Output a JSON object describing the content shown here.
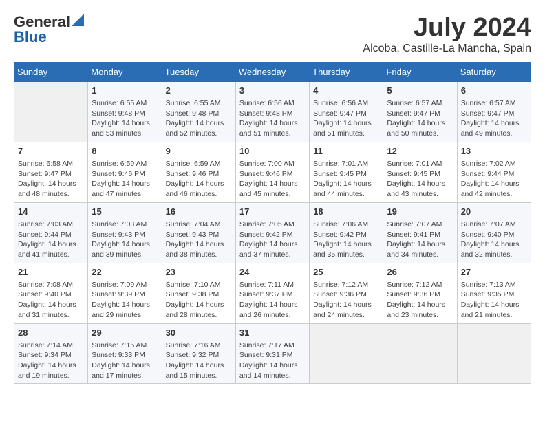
{
  "logo": {
    "general": "General",
    "blue": "Blue"
  },
  "title": "July 2024",
  "subtitle": "Alcoba, Castille-La Mancha, Spain",
  "weekdays": [
    "Sunday",
    "Monday",
    "Tuesday",
    "Wednesday",
    "Thursday",
    "Friday",
    "Saturday"
  ],
  "weeks": [
    [
      {
        "day": "",
        "empty": true
      },
      {
        "day": "1",
        "sunrise": "6:55 AM",
        "sunset": "9:48 PM",
        "daylight": "14 hours and 53 minutes."
      },
      {
        "day": "2",
        "sunrise": "6:55 AM",
        "sunset": "9:48 PM",
        "daylight": "14 hours and 52 minutes."
      },
      {
        "day": "3",
        "sunrise": "6:56 AM",
        "sunset": "9:48 PM",
        "daylight": "14 hours and 51 minutes."
      },
      {
        "day": "4",
        "sunrise": "6:56 AM",
        "sunset": "9:47 PM",
        "daylight": "14 hours and 51 minutes."
      },
      {
        "day": "5",
        "sunrise": "6:57 AM",
        "sunset": "9:47 PM",
        "daylight": "14 hours and 50 minutes."
      },
      {
        "day": "6",
        "sunrise": "6:57 AM",
        "sunset": "9:47 PM",
        "daylight": "14 hours and 49 minutes."
      }
    ],
    [
      {
        "day": "7",
        "sunrise": "6:58 AM",
        "sunset": "9:47 PM",
        "daylight": "14 hours and 48 minutes."
      },
      {
        "day": "8",
        "sunrise": "6:59 AM",
        "sunset": "9:46 PM",
        "daylight": "14 hours and 47 minutes."
      },
      {
        "day": "9",
        "sunrise": "6:59 AM",
        "sunset": "9:46 PM",
        "daylight": "14 hours and 46 minutes."
      },
      {
        "day": "10",
        "sunrise": "7:00 AM",
        "sunset": "9:46 PM",
        "daylight": "14 hours and 45 minutes."
      },
      {
        "day": "11",
        "sunrise": "7:01 AM",
        "sunset": "9:45 PM",
        "daylight": "14 hours and 44 minutes."
      },
      {
        "day": "12",
        "sunrise": "7:01 AM",
        "sunset": "9:45 PM",
        "daylight": "14 hours and 43 minutes."
      },
      {
        "day": "13",
        "sunrise": "7:02 AM",
        "sunset": "9:44 PM",
        "daylight": "14 hours and 42 minutes."
      }
    ],
    [
      {
        "day": "14",
        "sunrise": "7:03 AM",
        "sunset": "9:44 PM",
        "daylight": "14 hours and 41 minutes."
      },
      {
        "day": "15",
        "sunrise": "7:03 AM",
        "sunset": "9:43 PM",
        "daylight": "14 hours and 39 minutes."
      },
      {
        "day": "16",
        "sunrise": "7:04 AM",
        "sunset": "9:43 PM",
        "daylight": "14 hours and 38 minutes."
      },
      {
        "day": "17",
        "sunrise": "7:05 AM",
        "sunset": "9:42 PM",
        "daylight": "14 hours and 37 minutes."
      },
      {
        "day": "18",
        "sunrise": "7:06 AM",
        "sunset": "9:42 PM",
        "daylight": "14 hours and 35 minutes."
      },
      {
        "day": "19",
        "sunrise": "7:07 AM",
        "sunset": "9:41 PM",
        "daylight": "14 hours and 34 minutes."
      },
      {
        "day": "20",
        "sunrise": "7:07 AM",
        "sunset": "9:40 PM",
        "daylight": "14 hours and 32 minutes."
      }
    ],
    [
      {
        "day": "21",
        "sunrise": "7:08 AM",
        "sunset": "9:40 PM",
        "daylight": "14 hours and 31 minutes."
      },
      {
        "day": "22",
        "sunrise": "7:09 AM",
        "sunset": "9:39 PM",
        "daylight": "14 hours and 29 minutes."
      },
      {
        "day": "23",
        "sunrise": "7:10 AM",
        "sunset": "9:38 PM",
        "daylight": "14 hours and 28 minutes."
      },
      {
        "day": "24",
        "sunrise": "7:11 AM",
        "sunset": "9:37 PM",
        "daylight": "14 hours and 26 minutes."
      },
      {
        "day": "25",
        "sunrise": "7:12 AM",
        "sunset": "9:36 PM",
        "daylight": "14 hours and 24 minutes."
      },
      {
        "day": "26",
        "sunrise": "7:12 AM",
        "sunset": "9:36 PM",
        "daylight": "14 hours and 23 minutes."
      },
      {
        "day": "27",
        "sunrise": "7:13 AM",
        "sunset": "9:35 PM",
        "daylight": "14 hours and 21 minutes."
      }
    ],
    [
      {
        "day": "28",
        "sunrise": "7:14 AM",
        "sunset": "9:34 PM",
        "daylight": "14 hours and 19 minutes."
      },
      {
        "day": "29",
        "sunrise": "7:15 AM",
        "sunset": "9:33 PM",
        "daylight": "14 hours and 17 minutes."
      },
      {
        "day": "30",
        "sunrise": "7:16 AM",
        "sunset": "9:32 PM",
        "daylight": "14 hours and 15 minutes."
      },
      {
        "day": "31",
        "sunrise": "7:17 AM",
        "sunset": "9:31 PM",
        "daylight": "14 hours and 14 minutes."
      },
      {
        "day": "",
        "empty": true
      },
      {
        "day": "",
        "empty": true
      },
      {
        "day": "",
        "empty": true
      }
    ]
  ]
}
